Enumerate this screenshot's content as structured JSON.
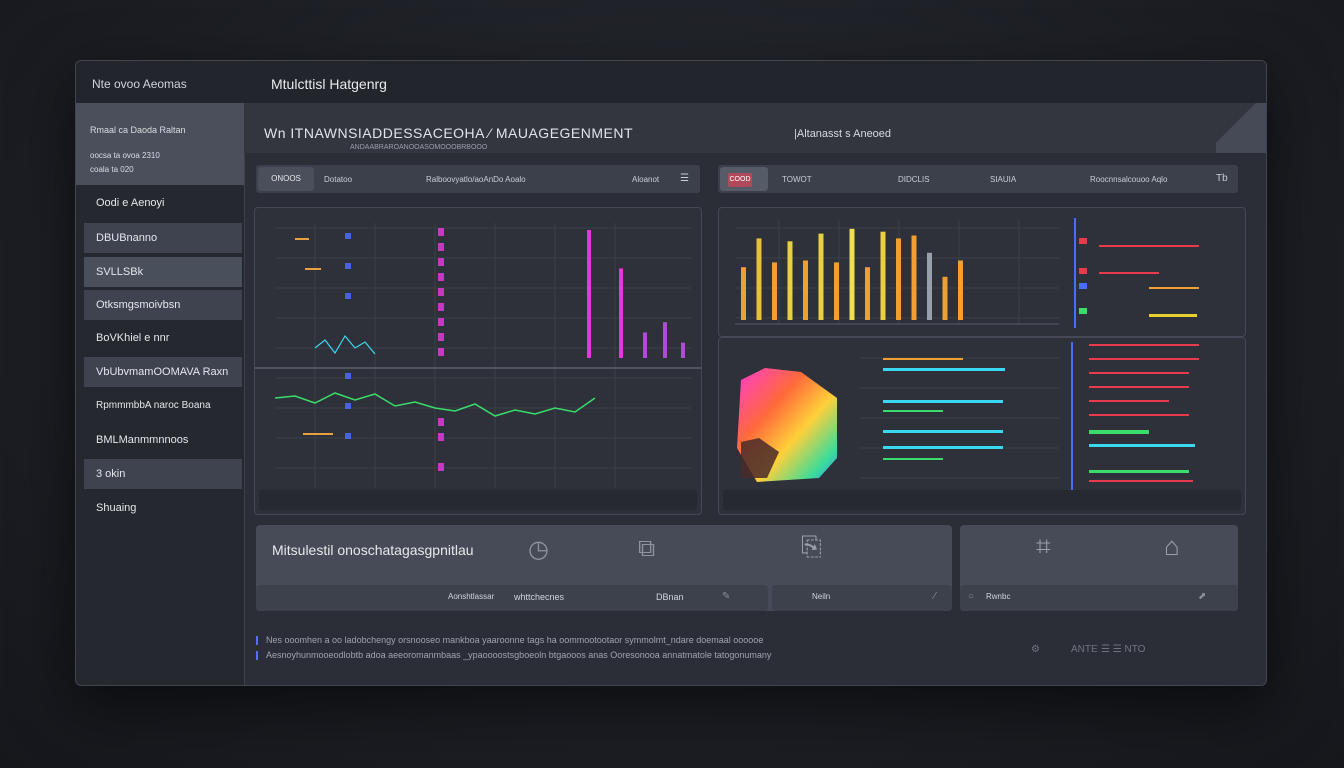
{
  "app_name": "Nte ovoo Aeomas",
  "window_title": "Mtulcttisl Hatgenrg",
  "sidebar": {
    "profile": {
      "line1": "Rmaal  ca    Daoda Raltan",
      "line2": "oocsa  ta  ovoa  2310",
      "line3": "coala  ta    020"
    },
    "items": [
      {
        "label": "Oodi e Aenoyi"
      },
      {
        "label": "DBUBnanno"
      },
      {
        "label": "SVLLSBk"
      },
      {
        "label": "Otksmgsmoivbsn"
      },
      {
        "label": "BoVKhiel e nnr"
      },
      {
        "label": "VbUbvmamOOMAVA Raxn"
      },
      {
        "label": "RpmmmbbA naroc Boana"
      },
      {
        "label": "BMLManmmnnoos"
      },
      {
        "label": "3 okin"
      },
      {
        "label": "Shuaing"
      }
    ]
  },
  "header": {
    "title": "Wn  ITNAWNSIADDESSACEOHA  ⁄  MAUAGEGENMENT",
    "subtitle": "ANDAABRAROANOOASOMOOOBRBOOO",
    "right": "|Altanasst s Aneoed"
  },
  "left_toolbar": {
    "chip": "ONOOS",
    "t1": "Dotatoo",
    "t2": "Ralboovyatlo/aoAnDo  Aoalo",
    "t3": "Aloanot"
  },
  "right_toolbar": {
    "chip": "COOD",
    "t1": "TOWOT",
    "t2": "DIDCLIS",
    "t3": "SIAUIA",
    "t4": "Roocnnsalcouoo Aqlo",
    "t5": "Tb"
  },
  "bottom_left_tile": {
    "title": "Mitsulestil onoschatagasgpnitlau",
    "b1": "Aonshtlassar",
    "b2": "whttchecnes",
    "b3": "DBnan",
    "b4": "Neiln"
  },
  "bottom_right_tile": {
    "b1": "Rwnbc"
  },
  "notes": {
    "line1": "Nes ooomhen a  oo  ladobchengy orsnooseo mankboa  yaaroonne tags  ha  oommootootaor  symmolmt_ndare  doemaal oooooe",
    "line2": "Aesnoyhunmooeodlobtb adoa  aeeoromanmbaas  _ypaoooostsgboeoln btgaooos anas  Ooresonooa  annatmatole tatogonumany"
  },
  "footer_controls": {
    "c1": "ANTE",
    "c2": "☰ ☰ NTO"
  },
  "colors": {
    "accent_magenta": "#e23ad8",
    "accent_orange": "#f0a030",
    "accent_cyan": "#38d8f0",
    "accent_red": "#e83a4a",
    "accent_green": "#3adc6a",
    "accent_blue": "#4a6cff"
  },
  "chart_data": [
    {
      "type": "bar",
      "title": "",
      "series": [
        {
          "name": "",
          "values": [
            100,
            70,
            20,
            28,
            12
          ]
        }
      ],
      "ylim": [
        0,
        100
      ]
    },
    {
      "type": "bar",
      "title": "",
      "series": [
        {
          "name": "",
          "values": [
            55,
            85,
            60,
            82,
            62,
            90,
            60,
            95,
            55,
            92,
            85,
            88,
            70,
            45,
            62
          ]
        }
      ],
      "ylim": [
        0,
        100
      ]
    }
  ]
}
